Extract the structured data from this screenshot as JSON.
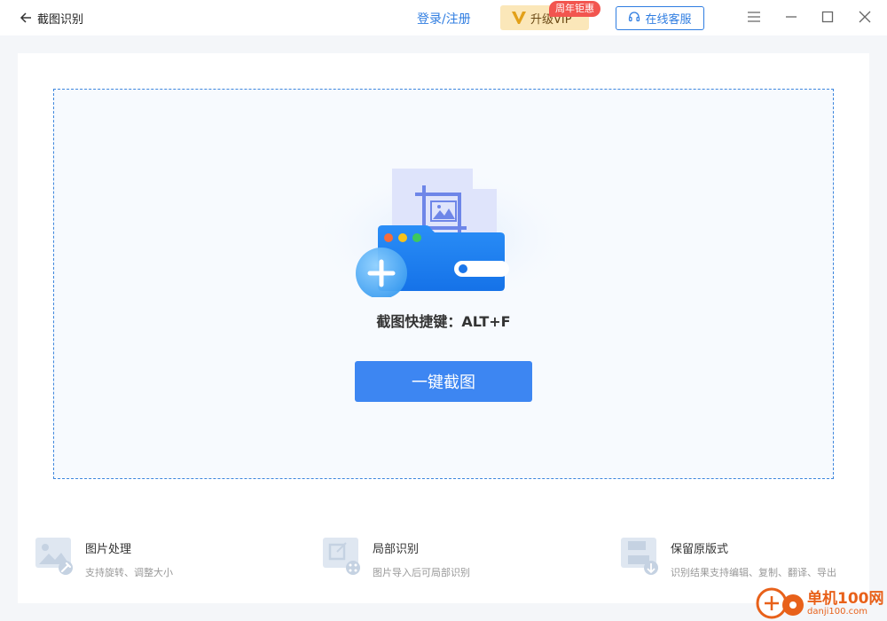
{
  "titlebar": {
    "title": "截图识别",
    "login_label": "登录/注册",
    "vip_label": "升级VIP",
    "vip_badge": "周年钜惠",
    "service_label": "在线客服"
  },
  "main": {
    "hotkey_text": "截图快捷键：ALT+F",
    "capture_button": "一键截图"
  },
  "features": [
    {
      "name": "图片处理",
      "desc": "支持旋转、调整大小",
      "icon": "image-edit-icon"
    },
    {
      "name": "局部识别",
      "desc": "图片导入后可局部识别",
      "icon": "crop-icon"
    },
    {
      "name": "保留原版式",
      "desc": "识别结果支持编辑、复制、翻译、导出",
      "icon": "save-icon"
    }
  ],
  "watermark": {
    "brand": "单机100网",
    "url": "danji100.com"
  },
  "colors": {
    "accent": "#3d86f2",
    "link": "#2f7de1",
    "vip_bg": "#fbe7b9",
    "badge": "#f2554f"
  }
}
